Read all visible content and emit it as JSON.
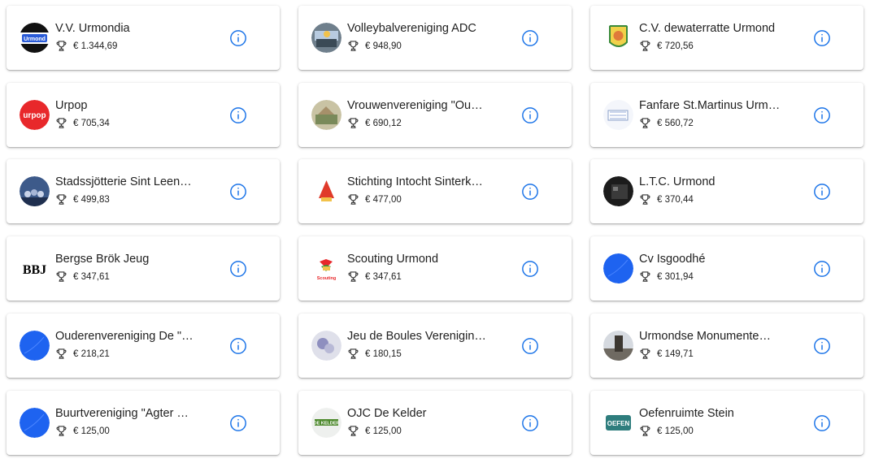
{
  "cards": [
    {
      "name": "V.V. Urmondia",
      "amount": "€ 1.344,69",
      "logo_text": "Urmond"
    },
    {
      "name": "Volleybalvereniging ADC",
      "amount": "€ 948,90"
    },
    {
      "name": "C.V. dewaterratte Urmond",
      "amount": "€ 720,56"
    },
    {
      "name": "Urpop",
      "amount": "€ 705,34",
      "logo_text": "urpop"
    },
    {
      "name": "Vrouwenvereniging \"Ou…",
      "amount": "€ 690,12"
    },
    {
      "name": "Fanfare St.Martinus Urm…",
      "amount": "€ 560,72"
    },
    {
      "name": "Stadssjötterie Sint Leen…",
      "amount": "€ 499,83"
    },
    {
      "name": "Stichting Intocht Sinterk…",
      "amount": "€ 477,00"
    },
    {
      "name": "L.T.C. Urmond",
      "amount": "€ 370,44"
    },
    {
      "name": "Bergse Brök Jeug",
      "amount": "€ 347,61",
      "logo_text": "BBJ"
    },
    {
      "name": "Scouting Urmond",
      "amount": "€ 347,61",
      "logo_text": "Scouting"
    },
    {
      "name": "Cv Isgoodhé",
      "amount": "€ 301,94"
    },
    {
      "name": "Ouderenvereniging De \"…",
      "amount": "€ 218,21"
    },
    {
      "name": "Jeu de Boules Verenigin…",
      "amount": "€ 180,15"
    },
    {
      "name": "Urmondse Monumente…",
      "amount": "€ 149,71"
    },
    {
      "name": "Buurtvereniging \"Agter …",
      "amount": "€ 125,00"
    },
    {
      "name": "OJC De Kelder",
      "amount": "€ 125,00",
      "logo_text": "DE KELDER"
    },
    {
      "name": "Oefenruimte Stein",
      "amount": "€ 125,00",
      "logo_text": "OEFEN"
    }
  ],
  "colors": {
    "accent": "#1a73e8",
    "text": "#212121"
  },
  "icons": {
    "amount": "trophy-icon",
    "info": "info-icon"
  }
}
